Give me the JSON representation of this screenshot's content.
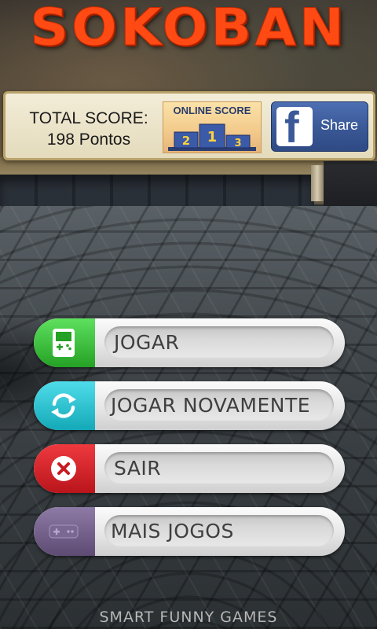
{
  "title": "SOKOBAN",
  "score": {
    "label": "TOTAL SCORE:",
    "value": "198 Pontos"
  },
  "online_score": {
    "label": "ONLINE SCORE",
    "podium": [
      "2",
      "1",
      "3"
    ]
  },
  "facebook": {
    "logo": "f",
    "label": "Share"
  },
  "menu": [
    {
      "label": "JOGAR",
      "icon": "gamepad-handheld-icon",
      "color": "#2fb52f"
    },
    {
      "label": "JOGAR NOVAMENTE",
      "icon": "refresh-icon",
      "color": "#19b8c8"
    },
    {
      "label": "SAIR",
      "icon": "close-icon",
      "color": "#d21e24"
    },
    {
      "label": "MAIS JOGOS",
      "icon": "controller-icon",
      "color": "#6e5b84"
    }
  ],
  "footer": "SMART FUNNY GAMES",
  "colors": {
    "title": "#ff4a14",
    "panel_bg": "#efe7cc",
    "facebook": "#3b5998"
  }
}
